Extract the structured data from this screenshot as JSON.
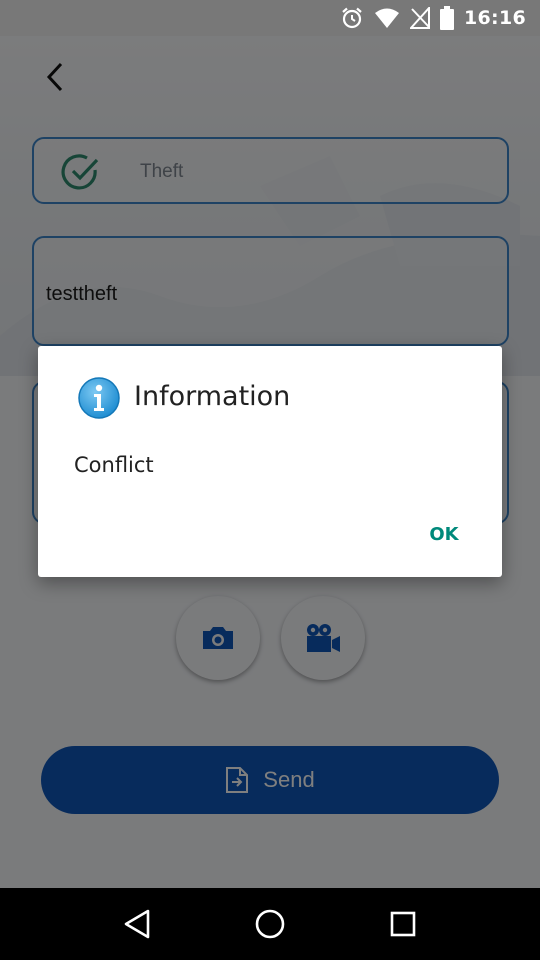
{
  "status_bar": {
    "time": "16:16",
    "icons": [
      "alarm-icon",
      "wifi-icon",
      "no-sim-icon",
      "battery-icon"
    ]
  },
  "toolbar": {
    "back_icon": "chevron-left-icon"
  },
  "form": {
    "category_value": "Theft",
    "title_value": "testtheft",
    "description_value": ""
  },
  "media": {
    "photo_icon": "camera-icon",
    "video_icon": "video-camera-icon"
  },
  "send": {
    "label": "Send",
    "icon": "document-export-icon"
  },
  "dialog": {
    "icon": "info-icon",
    "title": "Information",
    "message": "Conflict",
    "ok_label": "OK"
  },
  "colors": {
    "accent_blue": "#0f56b8",
    "field_border": "#3d84c8",
    "ok_teal": "#00897b",
    "check_teal": "#2e8b6e"
  },
  "navigation": [
    "back-triangle-icon",
    "home-circle-icon",
    "recents-square-icon"
  ]
}
